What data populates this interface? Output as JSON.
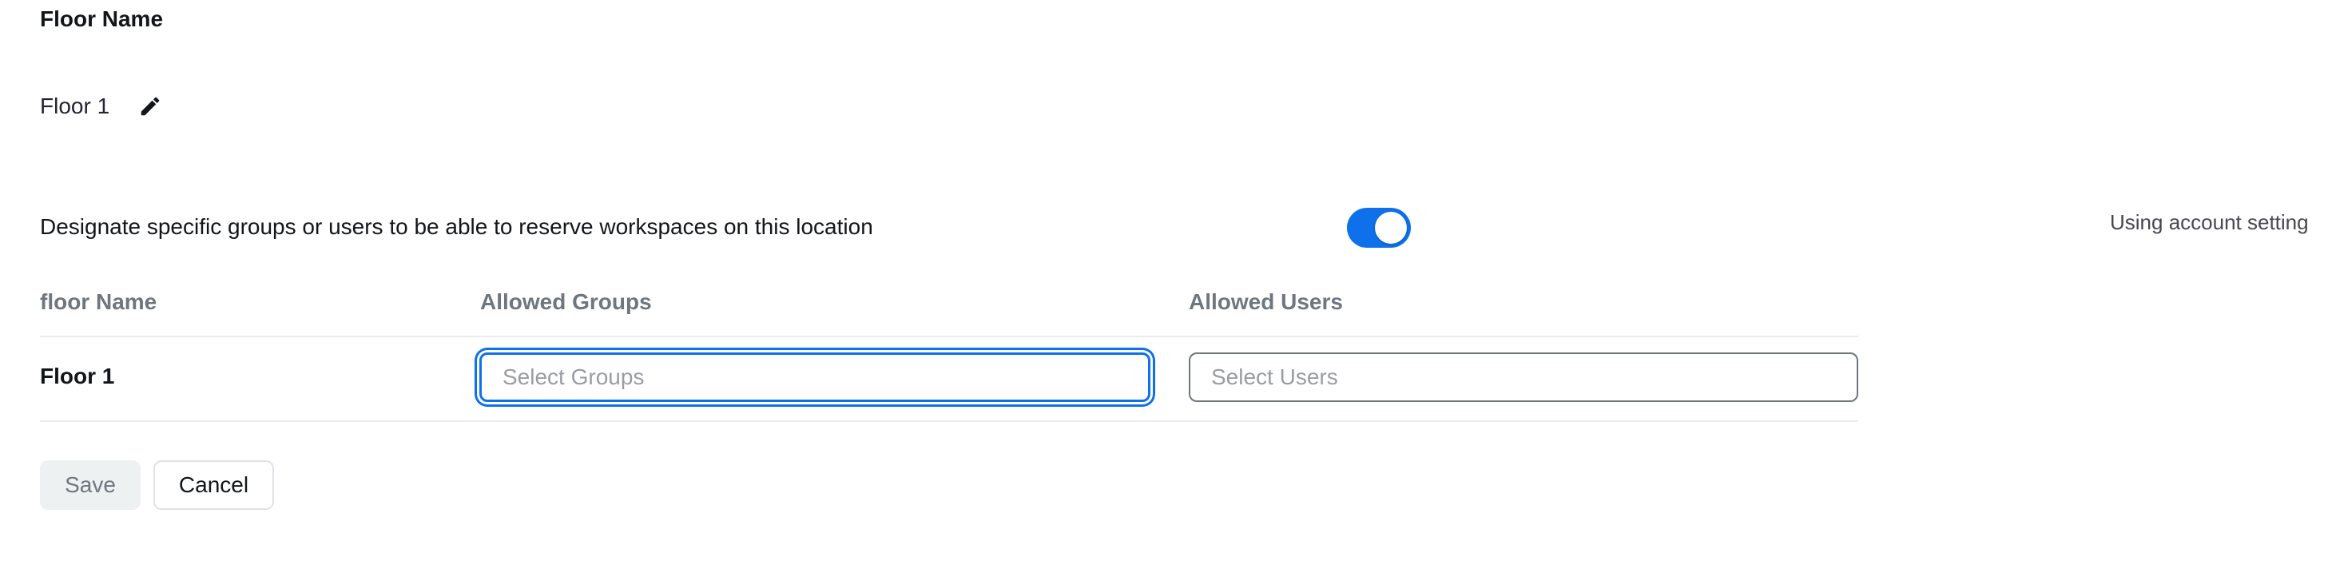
{
  "floor_section": {
    "label": "Floor Name",
    "value": "Floor 1",
    "edit_icon": "pencil-icon"
  },
  "designate": {
    "text": "Designate specific groups or users to be able to reserve workspaces on this location",
    "toggle_on": true,
    "accent_color": "#0e71eb",
    "status_text": "Using account setting"
  },
  "table": {
    "headers": [
      "floor Name",
      "Allowed Groups",
      "Allowed Users"
    ],
    "rows": [
      {
        "floor": "Floor 1",
        "groups_placeholder": "Select Groups",
        "users_placeholder": "Select Users"
      }
    ]
  },
  "actions": {
    "save_label": "Save",
    "cancel_label": "Cancel"
  }
}
